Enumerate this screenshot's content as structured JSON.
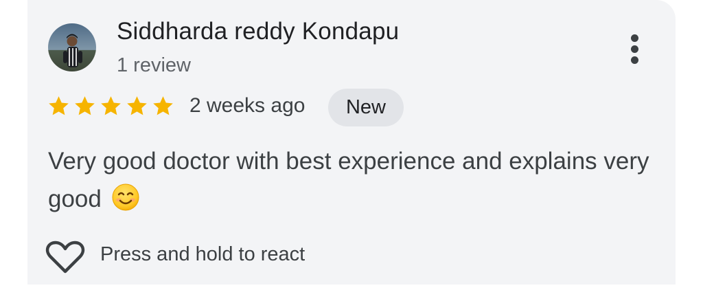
{
  "review": {
    "reviewer_name": "Siddharda reddy Kondapu",
    "review_count": "1 review",
    "rating": 5,
    "max_rating": 5,
    "date": "2 weeks ago",
    "badge": "New",
    "text": "Very good doctor with best experience and explains very good",
    "emoji": "smiling-face-icon",
    "react_hint": "Press and hold to react"
  },
  "colors": {
    "card_background": "#f3f4f6",
    "star": "#f6b400",
    "badge_background": "#e2e4e8",
    "primary_text": "#202124",
    "secondary_text": "#5f6368"
  },
  "icons": {
    "more": "more-vert-icon",
    "react": "heart-outline-icon",
    "rating": "star-icon"
  }
}
